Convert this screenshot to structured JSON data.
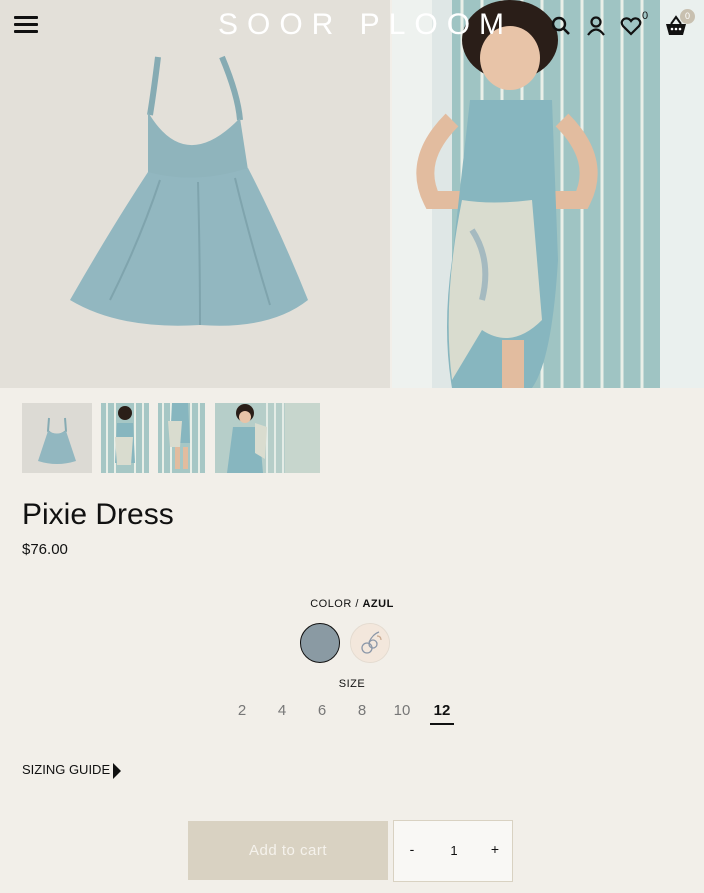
{
  "header": {
    "logo": "SOOR PLOOM",
    "wishlist_count": "0",
    "cart_count": "0"
  },
  "product": {
    "title": "Pixie Dress",
    "price": "$76.00",
    "color_label": "COLOR /",
    "color_selected": "AZUL",
    "size_label": "SIZE",
    "sizes": [
      "2",
      "4",
      "6",
      "8",
      "10",
      "12"
    ],
    "size_selected": "12",
    "sizing_guide": "SIZING GUIDE",
    "add_to_cart": "Add to cart",
    "quantity": "1",
    "qty_minus": "-",
    "qty_plus": "+"
  },
  "colors": {
    "background": "#f2efe9",
    "dress": "#8fb4bc",
    "azul_swatch": "#8a9aa3",
    "button": "#d9d2c2"
  }
}
